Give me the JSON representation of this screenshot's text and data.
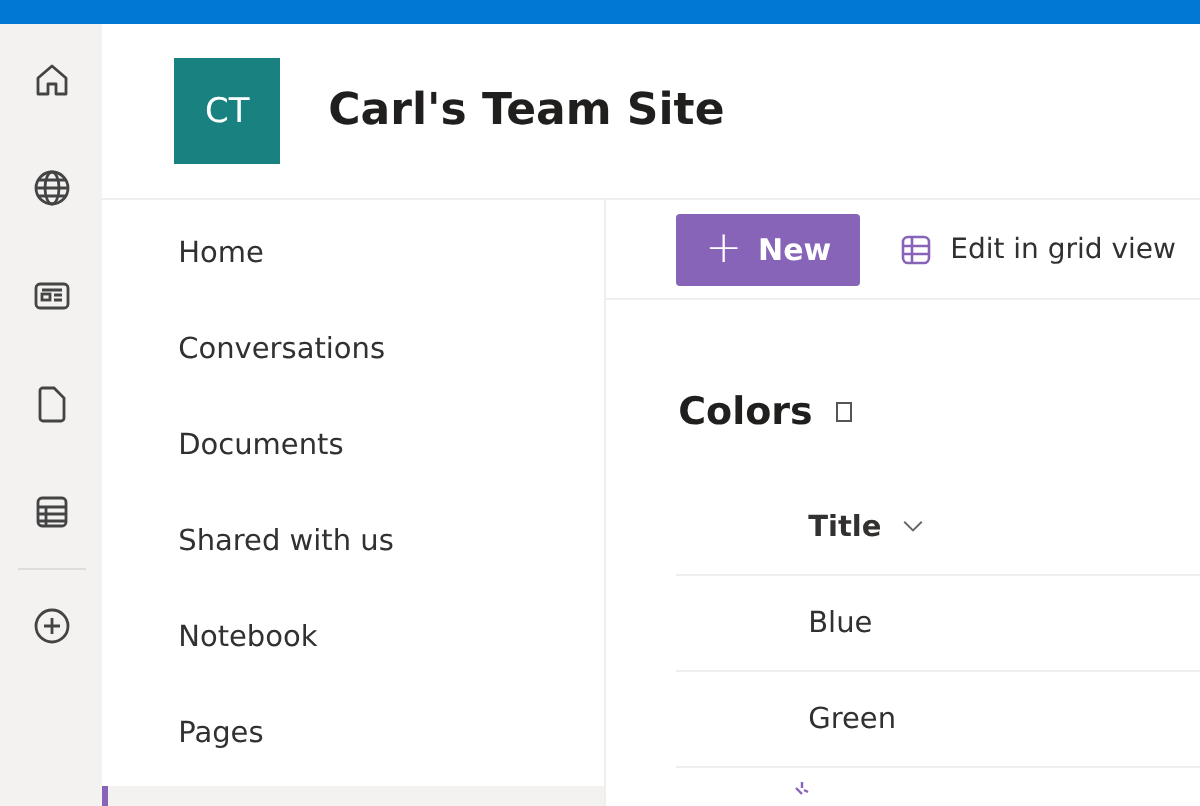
{
  "app_rail": {
    "items": [
      {
        "kind": "home"
      },
      {
        "kind": "globe"
      },
      {
        "kind": "news"
      },
      {
        "kind": "document"
      },
      {
        "kind": "list"
      }
    ],
    "create_button": {
      "kind": "add"
    }
  },
  "site_header": {
    "logo": "CT",
    "title": "Carl's Team Site"
  },
  "nav": {
    "items": [
      {
        "label": "Home",
        "selected": false
      },
      {
        "label": "Conversations",
        "selected": false
      },
      {
        "label": "Documents",
        "selected": false
      },
      {
        "label": "Shared with us",
        "selected": false
      },
      {
        "label": "Notebook",
        "selected": false
      },
      {
        "label": "Pages",
        "selected": false
      }
    ]
  },
  "command_bar": {
    "new_button": {
      "icon": "+",
      "label": "New"
    },
    "grid_button": {
      "label": "Edit in grid view"
    }
  },
  "list": {
    "title": "Colors",
    "columns": [
      {
        "label": "Title",
        "sortable": true
      }
    ],
    "rows": [
      {
        "title": "Blue",
        "loading": false
      },
      {
        "title": "Green",
        "loading": false
      },
      {
        "loading": true
      }
    ]
  }
}
